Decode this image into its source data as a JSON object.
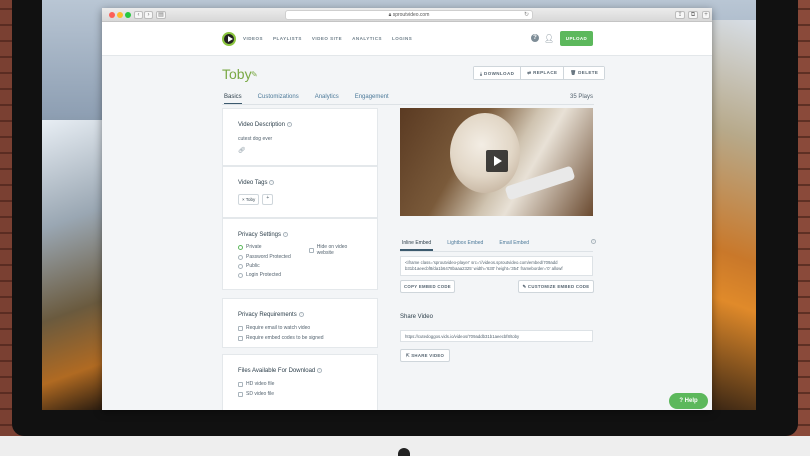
{
  "browser": {
    "url": "sproutvideo.com"
  },
  "nav": {
    "items": [
      "VIDEOS",
      "PLAYLISTS",
      "VIDEO SITE",
      "ANALYTICS",
      "LOGINS"
    ],
    "upload": "UPLOAD"
  },
  "video": {
    "title": "Toby",
    "plays": "35 Plays",
    "actions": {
      "download": "DOWNLOAD",
      "replace": "REPLACE",
      "delete": "DELETE"
    }
  },
  "tabs": [
    "Basics",
    "Customizations",
    "Analytics",
    "Engagement"
  ],
  "description": {
    "heading": "Video Description",
    "text": "cutest dog ever"
  },
  "tags": {
    "heading": "Video Tags",
    "items": [
      "Toby"
    ],
    "add": "+"
  },
  "privacy": {
    "heading": "Privacy Settings",
    "options": [
      "Private",
      "Password Protected",
      "Public",
      "Login Protected"
    ],
    "selected": "Private",
    "hide_label": "Hide on video website"
  },
  "requirements": {
    "heading": "Privacy Requirements",
    "items": [
      "Require email to watch video",
      "Require embed codes to be signed"
    ]
  },
  "files": {
    "heading": "Files Available For Download",
    "items": [
      "HD video file",
      "SD video file"
    ]
  },
  "embed": {
    "tabs": [
      "Inline Embed",
      "Lightbox Embed",
      "Email Embed"
    ],
    "code": "<iframe class='sproutvideo-player' src='//videos.sproutvideo.com/embed/709add b31b1aeecbf8/da1b6478baaa2325' width='630' height='354' frameborder='0' allowf",
    "copy": "COPY EMBED CODE",
    "customize": "CUSTOMIZE EMBED CODE"
  },
  "share": {
    "heading": "Share Video",
    "url": "https://cutedoggos.vids.io/videos/709addb31b1aeecbf8/toby",
    "button": "SHARE VIDEO"
  },
  "help": "Help"
}
